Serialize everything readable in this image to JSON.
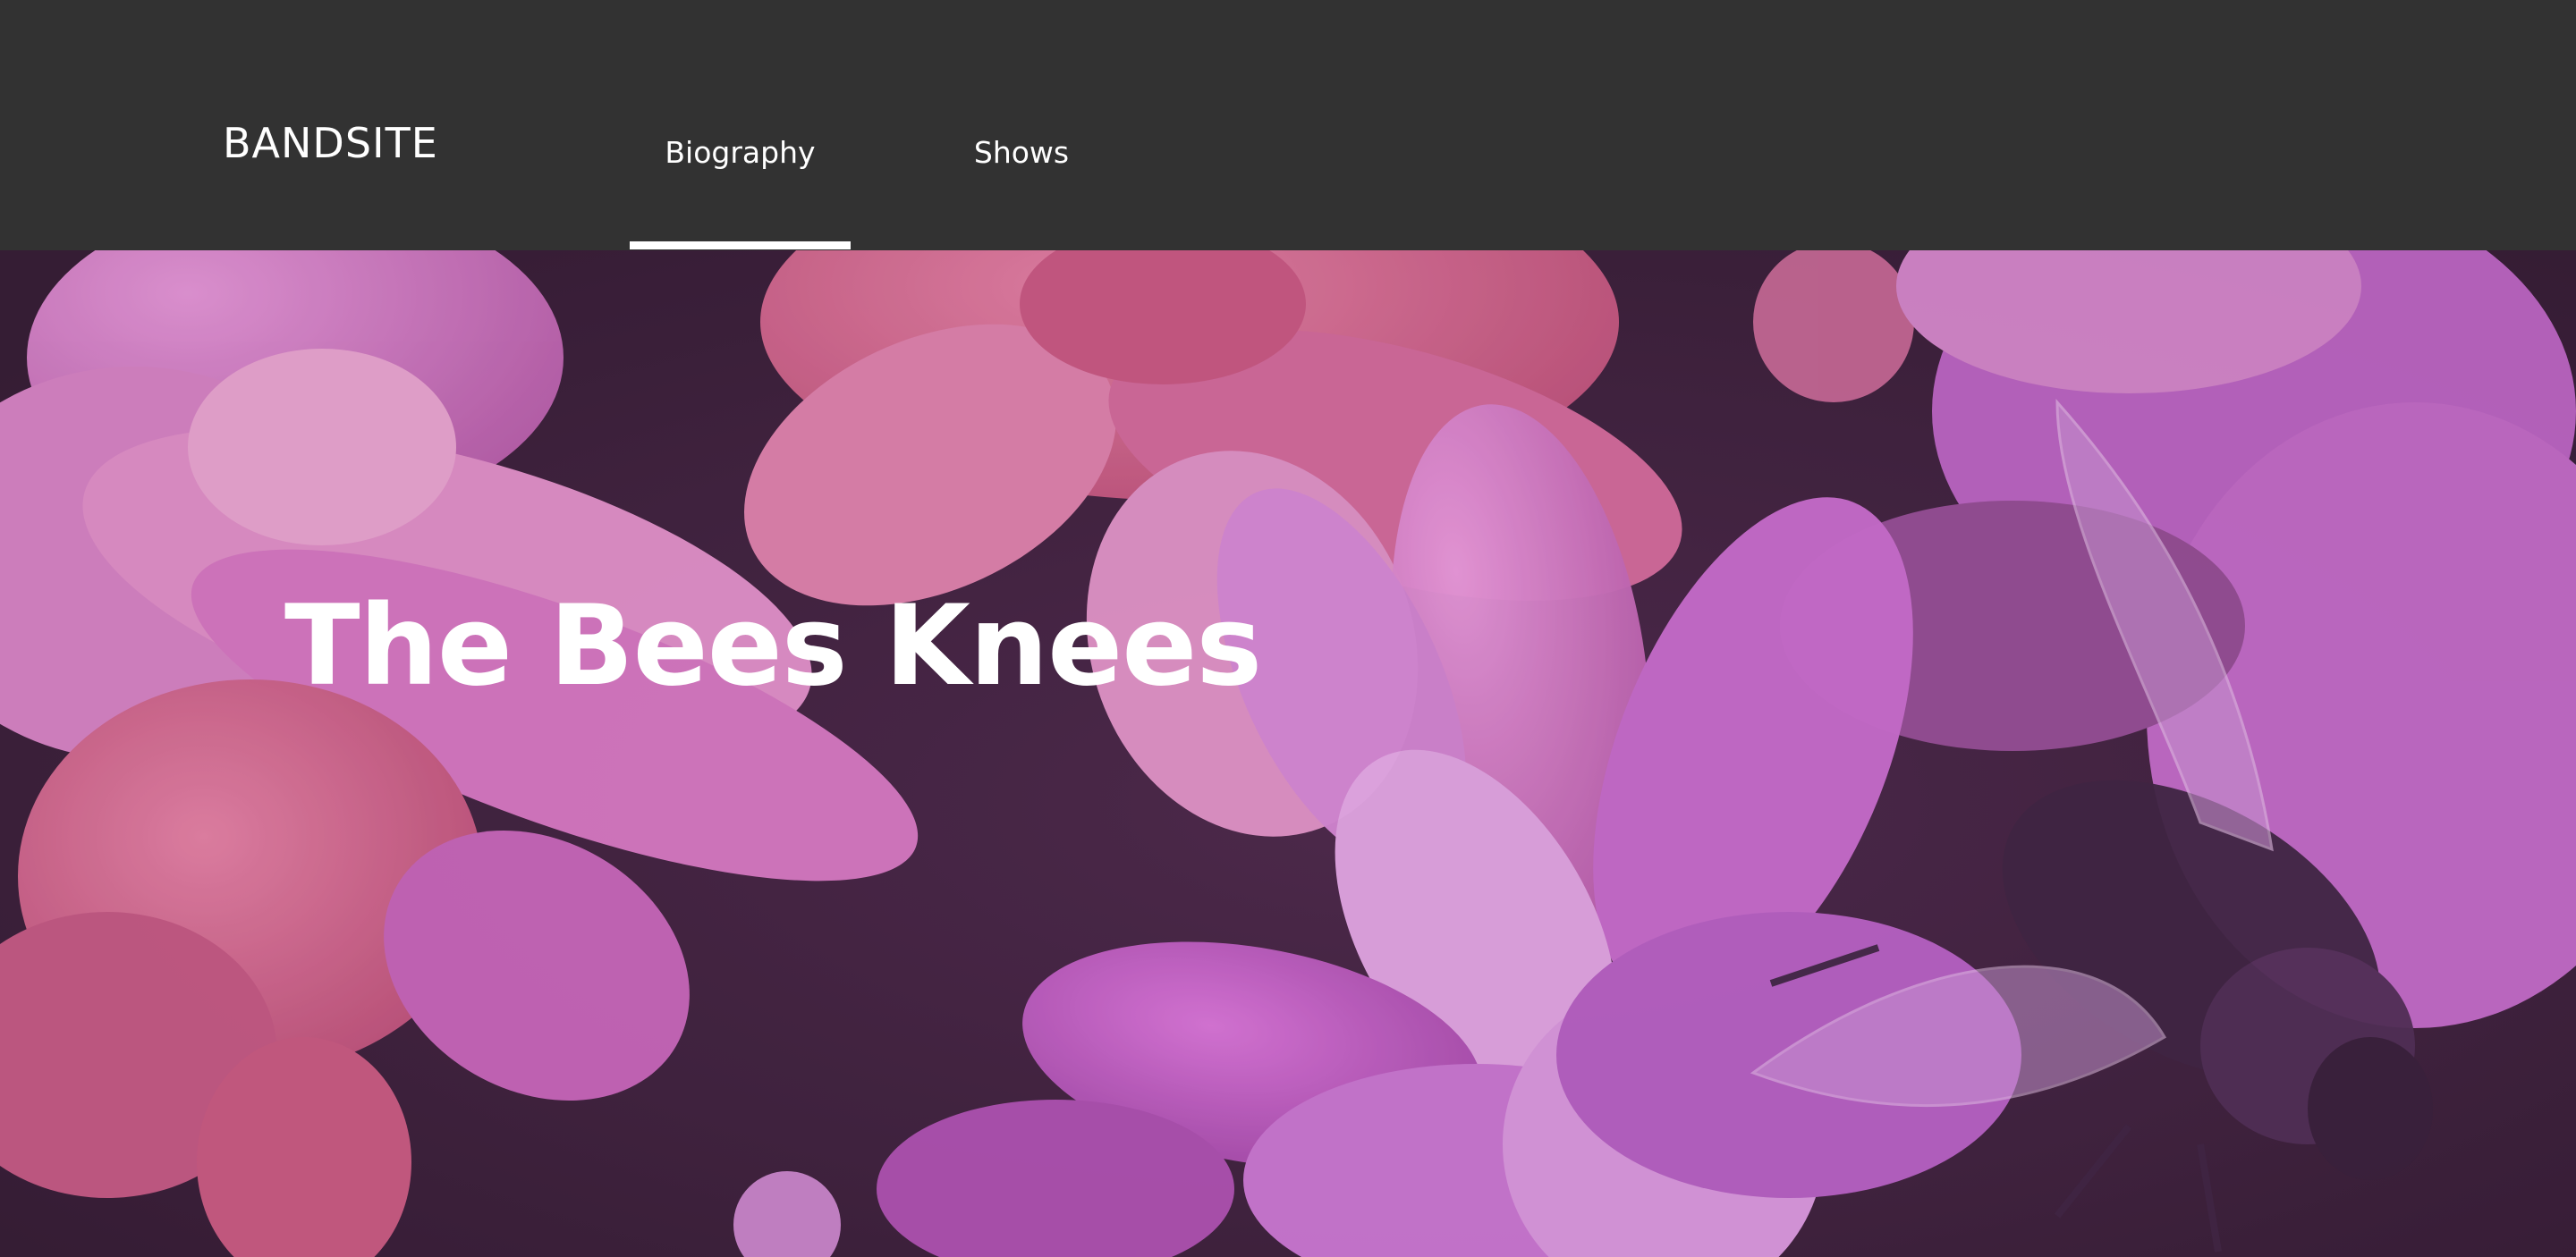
{
  "header": {
    "logo": "BANDSITE",
    "tabs": [
      {
        "label": "Biography",
        "active": true
      },
      {
        "label": "Shows",
        "active": false
      }
    ]
  },
  "hero": {
    "title": "The Bees Knees",
    "image": "flowers-with-bee"
  },
  "colors": {
    "header_bg": "#323232",
    "text": "#ffffff",
    "hero_tint": "#c04fc0",
    "hero_shadow": "#2c1f2b"
  }
}
